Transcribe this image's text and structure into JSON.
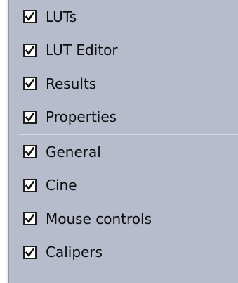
{
  "menu": {
    "groups": [
      {
        "items": [
          {
            "label": "LUTs",
            "checked": true
          },
          {
            "label": "LUT Editor",
            "checked": true
          },
          {
            "label": "Results",
            "checked": true
          },
          {
            "label": "Properties",
            "checked": true
          }
        ]
      },
      {
        "items": [
          {
            "label": "General",
            "checked": true
          },
          {
            "label": "Cine",
            "checked": true
          },
          {
            "label": "Mouse controls",
            "checked": true
          },
          {
            "label": "Calipers",
            "checked": true
          }
        ]
      }
    ],
    "colors": {
      "background": "#b6bccc",
      "separator": "#8c92a0",
      "text": "#0d0d0d"
    },
    "check_icon": "checkmark-icon"
  }
}
